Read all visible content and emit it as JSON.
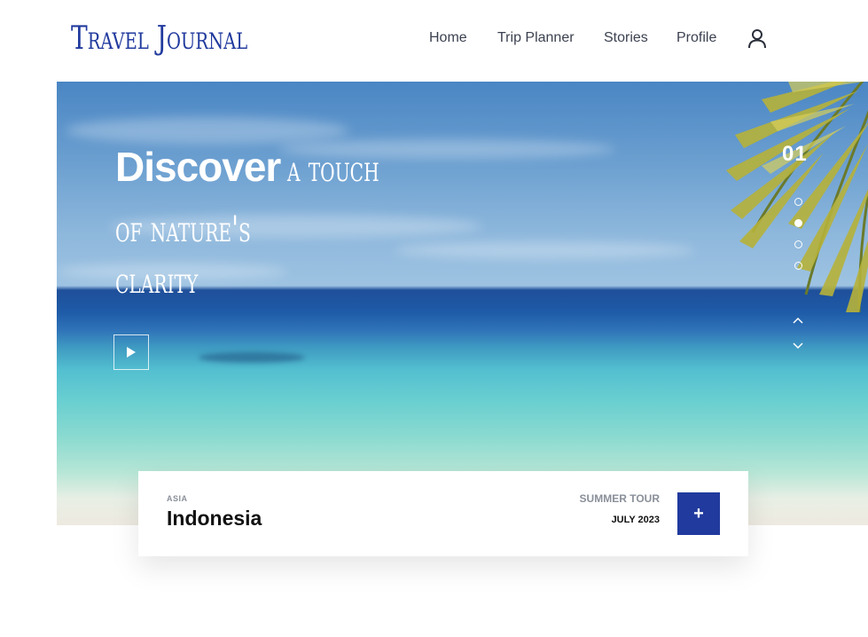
{
  "header": {
    "logo": "Travel Journal",
    "nav": [
      {
        "label": "Home"
      },
      {
        "label": "Trip Planner"
      },
      {
        "label": "Stories"
      },
      {
        "label": "Profile"
      }
    ],
    "user_icon": "user-icon"
  },
  "hero": {
    "headline_strong": "Discover",
    "headline_line1_rest": "a touch",
    "headline_line2": "of nature's",
    "headline_line3": "clarity",
    "slide_number": "01",
    "slides_total": 4,
    "active_slide": 2,
    "play_icon": "play-icon",
    "up_icon": "chevron-up-icon",
    "down_icon": "chevron-down-icon"
  },
  "card": {
    "region": "ASIA",
    "country": "Indonesia",
    "tour": "SUMMER TOUR",
    "date": "JULY 2023",
    "action": "+"
  },
  "colors": {
    "brand": "#213a9e",
    "nav_text": "#3c4150",
    "muted": "#8a8f99"
  }
}
